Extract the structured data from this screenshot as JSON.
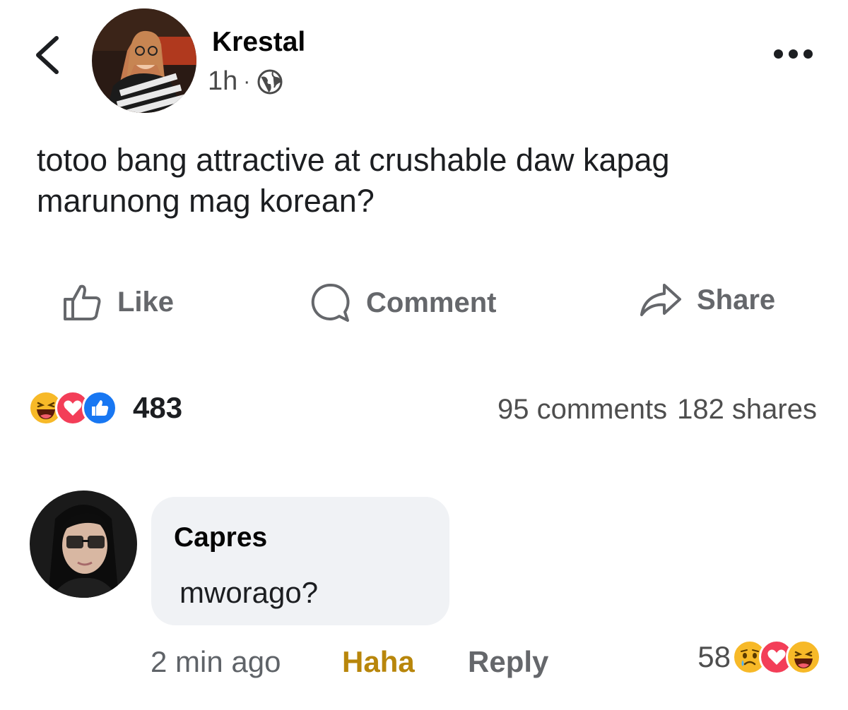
{
  "post": {
    "author": "Krestal",
    "time": "1h",
    "separator": "·",
    "privacy_icon": "globe-icon",
    "text": "totoo bang attractive at crushable daw kapag marunong mag korean?"
  },
  "actions": {
    "like_label": "Like",
    "comment_label": "Comment",
    "share_label": "Share"
  },
  "stats": {
    "reaction_count": "483",
    "reactions": [
      "haha-icon",
      "love-icon",
      "like-icon"
    ],
    "comments": "95 comments",
    "shares": "182 shares"
  },
  "comment": {
    "author": "Capres",
    "text": "mworago?",
    "time": "2 min ago",
    "user_reaction": "Haha",
    "reply_label": "Reply",
    "reaction_count": "58",
    "reactions": [
      "sad-icon",
      "love-icon",
      "haha-icon"
    ]
  },
  "colors": {
    "haha_yellow": "#f7b928",
    "love_red": "#f33e58",
    "like_blue": "#1877f2",
    "haha_label": "#b8860b",
    "bubble_bg": "#f0f2f5"
  }
}
